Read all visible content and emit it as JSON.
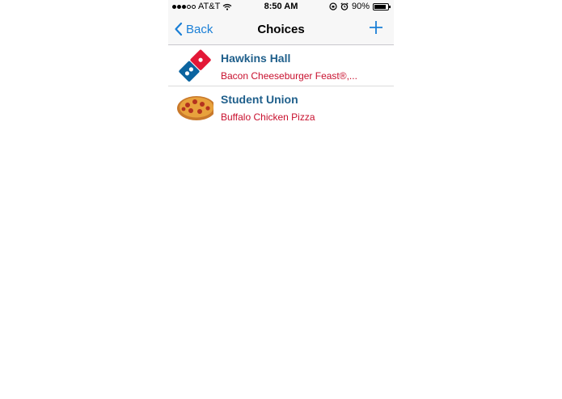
{
  "status_bar": {
    "carrier": "AT&T",
    "time": "8:50 AM",
    "battery": "90%",
    "battery_level": 0.9,
    "signal_icons": [
      "wifi-icon",
      "rotation-lock-icon",
      "alarm-icon"
    ]
  },
  "navbar": {
    "back_label": "Back",
    "title": "Choices",
    "add_icon": "plus-icon"
  },
  "choices": [
    {
      "title": "Hawkins Hall",
      "subtitle": "Bacon Cheeseburger Feast®,...",
      "icon": "dominos-logo"
    },
    {
      "title": "Student Union",
      "subtitle": "Buffalo Chicken Pizza",
      "icon": "pizza-image"
    }
  ],
  "colors": {
    "accent": "#1a7fd6",
    "title": "#1f5f8b",
    "subtitle": "#c8102e"
  }
}
